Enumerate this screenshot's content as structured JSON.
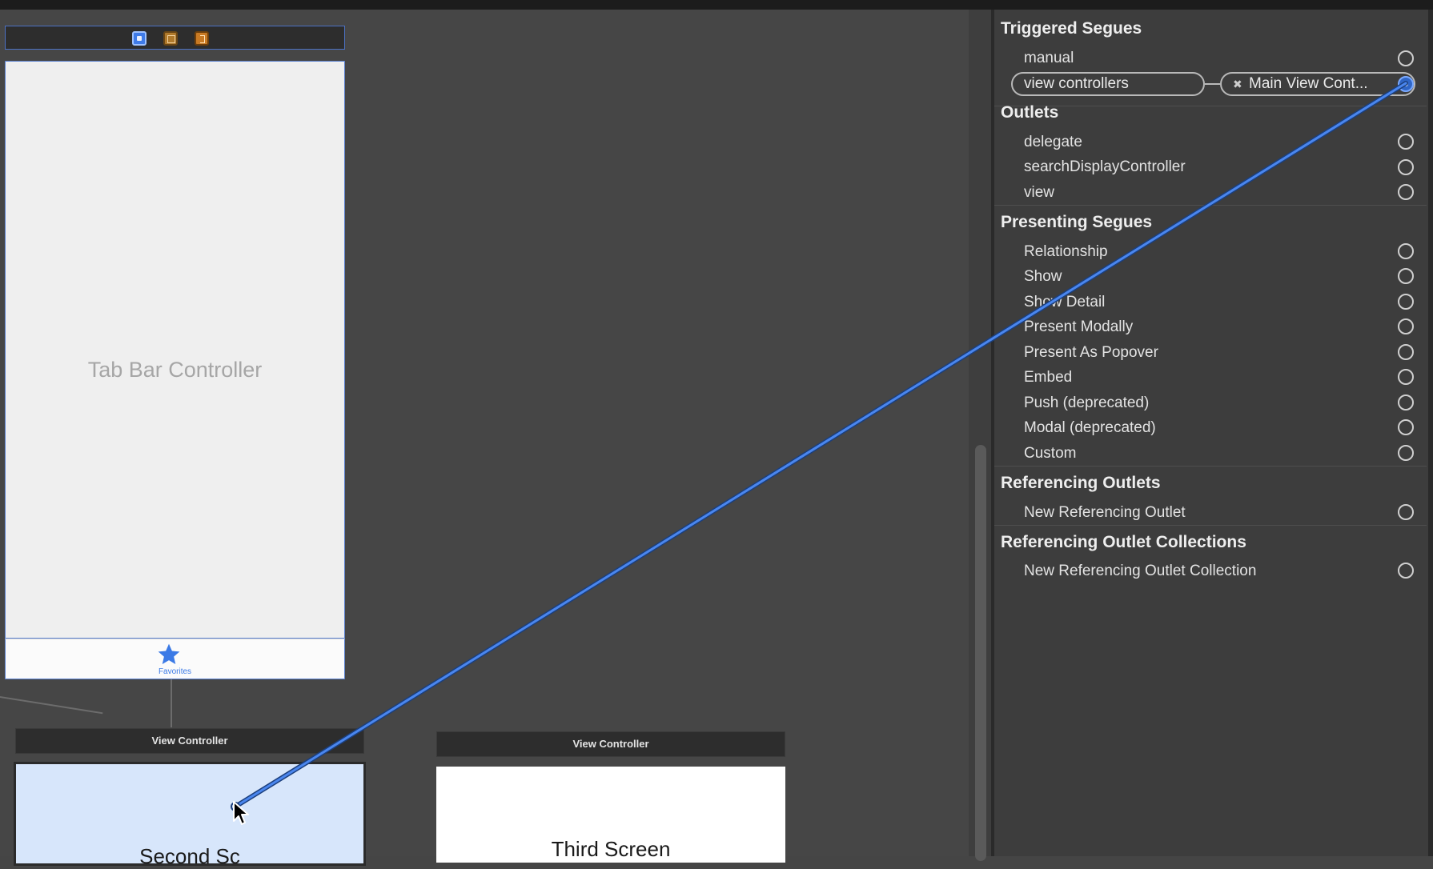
{
  "canvas": {
    "tab_bar_controller": {
      "title": "Tab Bar Controller",
      "tab_item": {
        "label": "Favorites",
        "icon": "star-icon"
      },
      "scene_icons": [
        "view-controller-icon",
        "first-responder-icon",
        "exit-icon"
      ]
    },
    "view_controller_1": {
      "header": "View Controller",
      "title": "Second Sc"
    },
    "view_controller_2": {
      "header": "View Controller",
      "title": "Third Screen"
    }
  },
  "inspector": {
    "triggered_segues": {
      "title": "Triggered Segues",
      "items": [
        {
          "label": "manual"
        },
        {
          "label": "view controllers",
          "connected_to": "Main View Cont..."
        }
      ]
    },
    "outlets": {
      "title": "Outlets",
      "items": [
        {
          "label": "delegate"
        },
        {
          "label": "searchDisplayController"
        },
        {
          "label": "view"
        }
      ]
    },
    "presenting_segues": {
      "title": "Presenting Segues",
      "items": [
        {
          "label": "Relationship"
        },
        {
          "label": "Show"
        },
        {
          "label": "Show Detail"
        },
        {
          "label": "Present Modally"
        },
        {
          "label": "Present As Popover"
        },
        {
          "label": "Embed"
        },
        {
          "label": "Push (deprecated)"
        },
        {
          "label": "Modal (deprecated)"
        },
        {
          "label": "Custom"
        }
      ]
    },
    "referencing_outlets": {
      "title": "Referencing Outlets",
      "items": [
        {
          "label": "New Referencing Outlet"
        }
      ]
    },
    "referencing_outlet_collections": {
      "title": "Referencing Outlet Collections",
      "items": [
        {
          "label": "New Referencing Outlet Collection"
        }
      ]
    }
  },
  "colors": {
    "connection_line": "#3f7be8",
    "accent": "#3b7ae6",
    "panel_bg": "#3d3d3d",
    "canvas_bg": "#464646"
  }
}
